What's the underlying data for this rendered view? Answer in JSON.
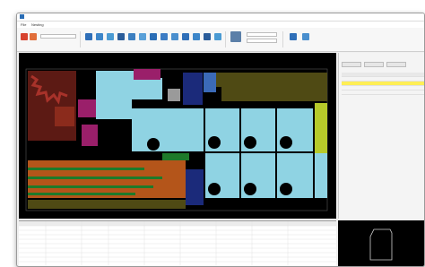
{
  "window": {
    "title": "",
    "menu": [
      "File",
      "Nesting"
    ]
  },
  "ribbon": {
    "combo_value": "",
    "groups": [
      "",
      "",
      "",
      ""
    ]
  },
  "canvas": {
    "status_text": "",
    "colors": {
      "cyan": "#8fd3e3",
      "olive": "#4f4a14",
      "maroon": "#5c1a14",
      "orange": "#b4551a",
      "green": "#1e7a2a",
      "magenta": "#9a1f6a",
      "navy": "#1b2a7a",
      "gray": "#9a9a9a",
      "lime": "#b7ca2a"
    }
  },
  "right_panel": {
    "title": "",
    "buttons": [
      "",
      "",
      ""
    ],
    "footer": ""
  },
  "bottom": {
    "highlight_value": ""
  }
}
